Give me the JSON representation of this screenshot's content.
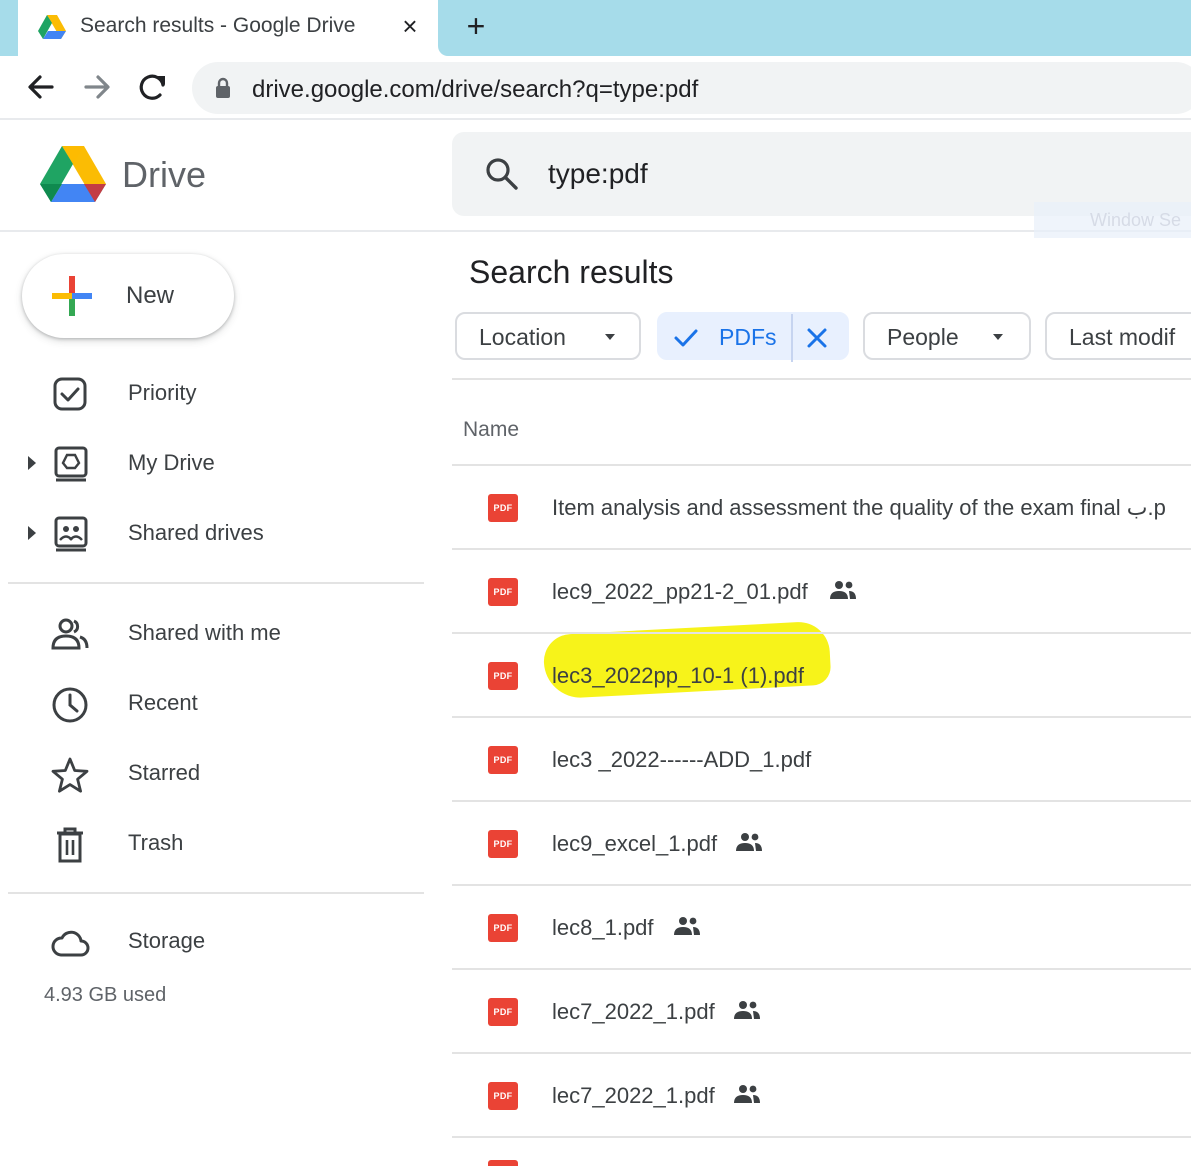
{
  "browser": {
    "tab_title": "Search results - Google Drive",
    "tab_close": "×",
    "new_tab": "+",
    "url": "drive.google.com/drive/search?q=type:pdf"
  },
  "app": {
    "name": "Drive",
    "search_value": "type:pdf",
    "ghost_text": "Window Se"
  },
  "sidebar": {
    "new_label": "New",
    "items": [
      {
        "label": "Priority"
      },
      {
        "label": "My Drive"
      },
      {
        "label": "Shared drives"
      },
      {
        "label": "Shared with me"
      },
      {
        "label": "Recent"
      },
      {
        "label": "Starred"
      },
      {
        "label": "Trash"
      },
      {
        "label": "Storage"
      }
    ],
    "storage_used": "4.93 GB used"
  },
  "main": {
    "title": "Search results",
    "filters": {
      "location": "Location",
      "pdfs": "PDFs",
      "people": "People",
      "last_modified": "Last modif"
    },
    "column_name": "Name",
    "files": [
      {
        "name": "Item analysis and assessment the quality of the exam final ب.p",
        "shared": false,
        "highlighted": false
      },
      {
        "name": "lec9_2022_pp21-2_01.pdf",
        "shared": true,
        "highlighted": false
      },
      {
        "name": "lec3_2022pp_10-1 (1).pdf",
        "shared": false,
        "highlighted": true
      },
      {
        "name": "lec3 _2022------ADD_1.pdf",
        "shared": false,
        "highlighted": false
      },
      {
        "name": "lec9_excel_1.pdf",
        "shared": true,
        "highlighted": false
      },
      {
        "name": "lec8_1.pdf",
        "shared": true,
        "highlighted": false
      },
      {
        "name": "lec7_2022_1.pdf",
        "shared": true,
        "highlighted": false
      },
      {
        "name": "lec7_2022_1.pdf",
        "shared": true,
        "highlighted": false
      }
    ],
    "pdf_badge": "PDF"
  },
  "colors": {
    "accent_blue": "#1a73e8",
    "pdf_red": "#ea4335",
    "highlight_yellow": "#f7f31a",
    "tab_strip": "#a6dcea"
  }
}
